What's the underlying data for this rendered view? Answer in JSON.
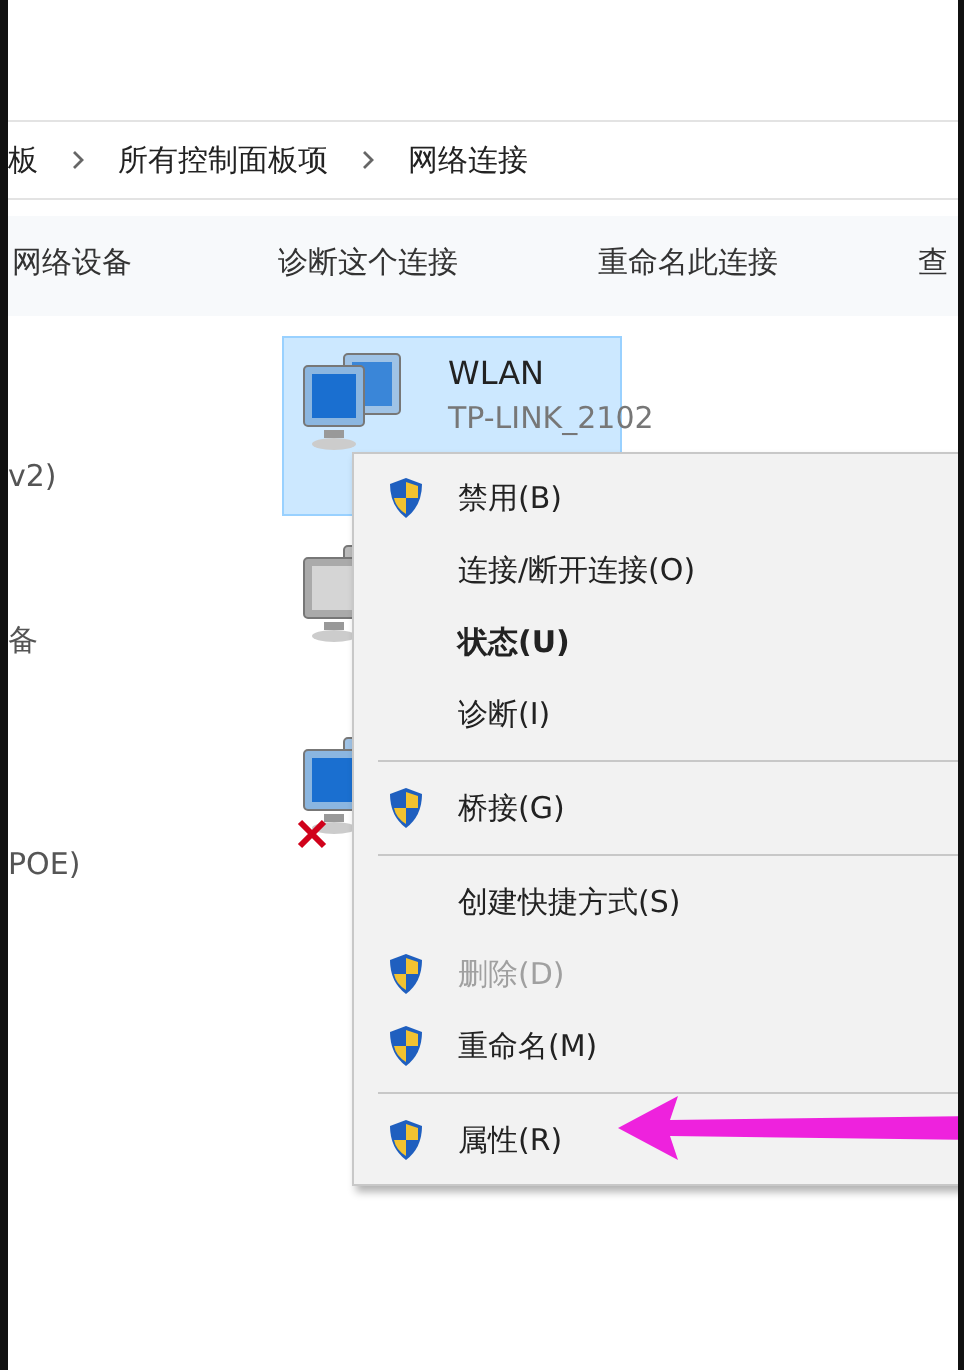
{
  "breadcrumb": [
    "板",
    "所有控制面板项",
    "网络连接"
  ],
  "toolbar": [
    "网络设备",
    "诊断这个连接",
    "重命名此连接",
    "查"
  ],
  "left_column": [
    "v2)",
    "备",
    "POE)"
  ],
  "connections": [
    {
      "name": "WLAN",
      "device": "TP-LINK_2102",
      "selected": true,
      "disabled": false,
      "error": false
    },
    {
      "selected": false,
      "disabled": true,
      "error": false
    },
    {
      "selected": false,
      "disabled": false,
      "error": true
    }
  ],
  "context_menu": [
    {
      "kind": "item",
      "label": "禁用(B)",
      "shield": true,
      "bold": false,
      "disabled": false
    },
    {
      "kind": "item",
      "label": "连接/断开连接(O)",
      "shield": false,
      "bold": false,
      "disabled": false
    },
    {
      "kind": "item",
      "label": "状态(U)",
      "shield": false,
      "bold": true,
      "disabled": false
    },
    {
      "kind": "item",
      "label": "诊断(I)",
      "shield": false,
      "bold": false,
      "disabled": false
    },
    {
      "kind": "separator"
    },
    {
      "kind": "item",
      "label": "桥接(G)",
      "shield": true,
      "bold": false,
      "disabled": false
    },
    {
      "kind": "separator"
    },
    {
      "kind": "item",
      "label": "创建快捷方式(S)",
      "shield": false,
      "bold": false,
      "disabled": false
    },
    {
      "kind": "item",
      "label": "删除(D)",
      "shield": true,
      "bold": false,
      "disabled": true
    },
    {
      "kind": "item",
      "label": "重命名(M)",
      "shield": true,
      "bold": false,
      "disabled": false
    },
    {
      "kind": "separator"
    },
    {
      "kind": "item",
      "label": "属性(R)",
      "shield": true,
      "bold": false,
      "disabled": false
    }
  ]
}
